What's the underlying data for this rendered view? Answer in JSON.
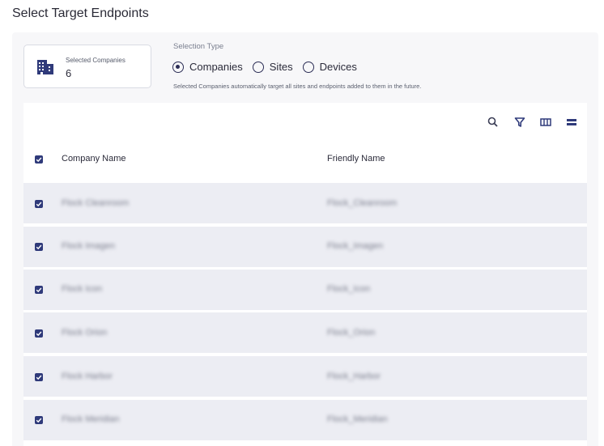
{
  "page": {
    "title": "Select Target Endpoints"
  },
  "summary": {
    "label": "Selected Companies",
    "value": "6",
    "icon": "building-icon"
  },
  "selection": {
    "label": "Selection Type",
    "options": [
      {
        "label": "Companies",
        "selected": true
      },
      {
        "label": "Sites",
        "selected": false
      },
      {
        "label": "Devices",
        "selected": false
      }
    ],
    "hint": "Selected Companies automatically target all sites and endpoints added to them in the future."
  },
  "toolbar": {
    "icons": [
      "search-icon",
      "filter-icon",
      "columns-icon",
      "density-icon"
    ]
  },
  "table": {
    "columns": [
      "Company Name",
      "Friendly Name"
    ],
    "all_selected": true,
    "rows": [
      {
        "company": "Flock Cleanroom",
        "friendly": "Flock_Cleanroom",
        "checked": true
      },
      {
        "company": "Flock Imagen",
        "friendly": "Flock_Imagen",
        "checked": true
      },
      {
        "company": "Flock Icon",
        "friendly": "Flock_Icon",
        "checked": true
      },
      {
        "company": "Flock Orion",
        "friendly": "Flock_Orion",
        "checked": true
      },
      {
        "company": "Flock Harbor",
        "friendly": "Flock_Harbor",
        "checked": true
      },
      {
        "company": "Flock Meridian",
        "friendly": "Flock_Meridian",
        "checked": true
      }
    ]
  },
  "colors": {
    "accent": "#2f3a7a",
    "row_bg": "#ecedf3",
    "panel_bg": "#f7f7f9"
  }
}
